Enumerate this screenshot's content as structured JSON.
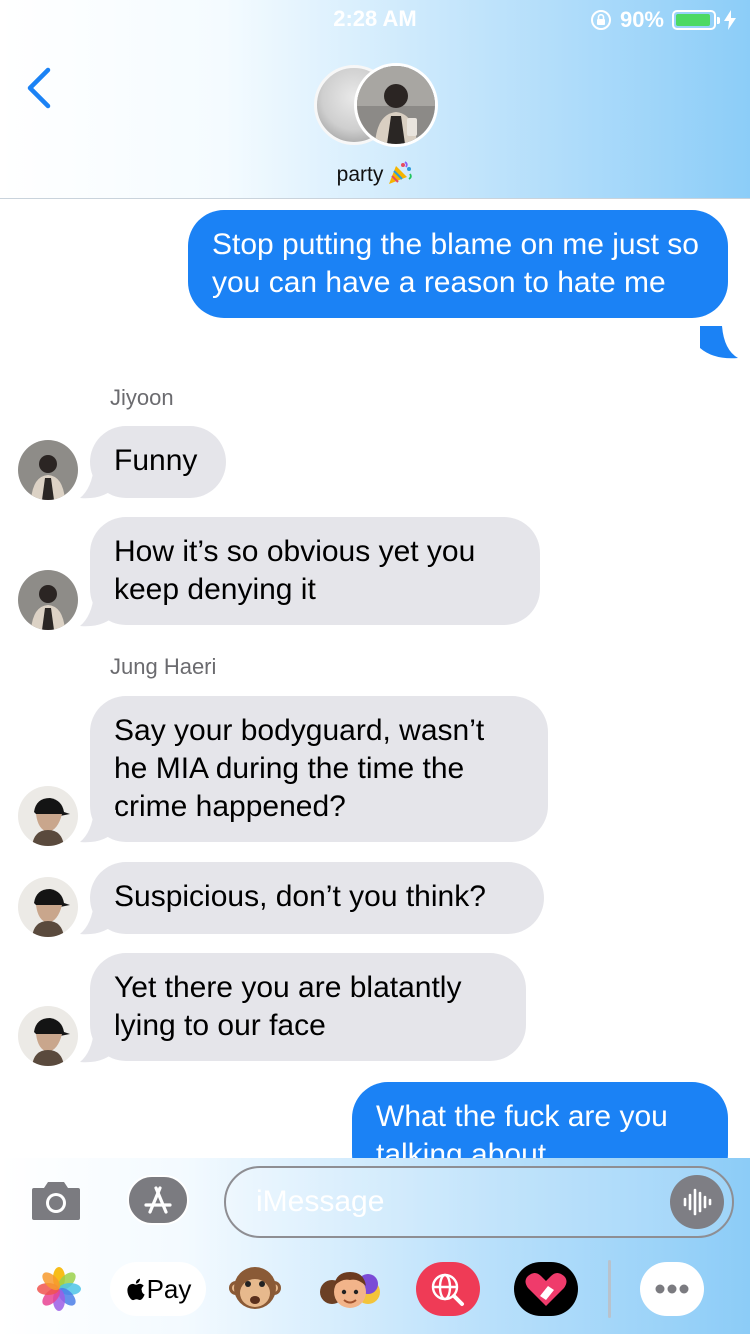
{
  "status_bar": {
    "time": "2:28 AM",
    "battery": "90%",
    "battery_level": 0.9
  },
  "header": {
    "group_name": "party"
  },
  "messages": [
    {
      "type": "sent",
      "text": "Stop putting the blame on me just so you can have a reason to hate me"
    },
    {
      "type": "sender",
      "text": "Jiyoon"
    },
    {
      "type": "received",
      "text": "Funny"
    },
    {
      "type": "received",
      "text": "How it’s so obvious yet you keep denying it"
    },
    {
      "type": "sender",
      "text": "Jung Haeri"
    },
    {
      "type": "received",
      "text": "Say your bodyguard, wasn’t he MIA during the time the crime happened?"
    },
    {
      "type": "received",
      "text": "Suspicious, don’t you think?"
    },
    {
      "type": "received",
      "text": "Yet there you are blatantly lying to our face"
    },
    {
      "type": "sent",
      "text": "What the fuck are you talking about"
    }
  ],
  "input": {
    "placeholder": "iMessage"
  },
  "drawer": {
    "apple_pay_label": "Pay"
  },
  "icons": {
    "back": "chevron-left-icon",
    "lock": "orientation-lock-icon",
    "charging": "bolt-icon",
    "camera": "camera-icon",
    "appstore": "app-store-icon",
    "audio": "waveform-icon",
    "photos": "photos-icon",
    "apple": "apple-logo-icon",
    "animoji": "monkey-animoji-icon",
    "memoji": "memoji-icon",
    "search": "globe-search-icon",
    "digital_touch": "heart-icon",
    "more": "more-icon"
  },
  "colors": {
    "sent_bubble": "#1b82f5",
    "received_bubble": "#e5e5ea",
    "back_arrow": "#1b82f5",
    "battery_fill": "#4cd964"
  }
}
